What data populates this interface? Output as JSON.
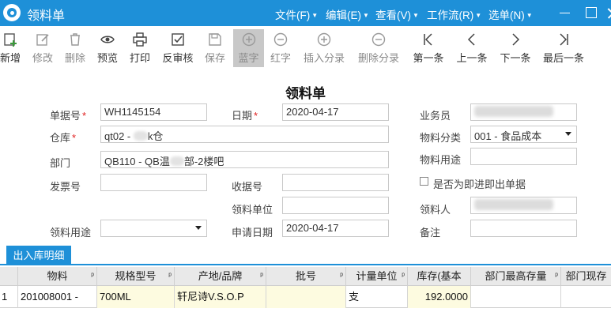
{
  "window": {
    "title": "领料单",
    "menus": [
      {
        "label": "文件(F)"
      },
      {
        "label": "编辑(E)"
      },
      {
        "label": "查看(V)"
      },
      {
        "label": "工作流(R)"
      },
      {
        "label": "选单(N)"
      }
    ]
  },
  "toolbar": {
    "buttons": [
      {
        "label": "新增",
        "icon": "add-icon"
      },
      {
        "label": "修改",
        "icon": "edit-icon"
      },
      {
        "label": "删除",
        "icon": "trash-icon"
      },
      {
        "label": "预览",
        "icon": "eye-icon"
      },
      {
        "label": "打印",
        "icon": "printer-icon"
      },
      {
        "label": "反审核",
        "icon": "checkbox-icon"
      },
      {
        "label": "保存",
        "icon": "save-icon"
      },
      {
        "label": "蓝字",
        "icon": "plus-circle-icon"
      },
      {
        "label": "红字",
        "icon": "minus-circle-icon"
      },
      {
        "label": "插入分录",
        "icon": "plus-circle-icon"
      },
      {
        "label": "删除分录",
        "icon": "minus-circle-icon"
      },
      {
        "label": "第一条",
        "icon": "first-icon"
      },
      {
        "label": "上一条",
        "icon": "prev-icon"
      },
      {
        "label": "下一条",
        "icon": "next-icon"
      },
      {
        "label": "最后一条",
        "icon": "last-icon"
      }
    ]
  },
  "form": {
    "title": "领料单",
    "bill_no_label": "单据号",
    "bill_no": "WH1145154",
    "date_label": "日期",
    "date": "2020-04-17",
    "clerk_label": "业务员",
    "warehouse_label": "仓库",
    "warehouse_prefix": "qt02 - ",
    "warehouse_suffix": "k仓",
    "category_label": "物料分类",
    "category": "001 - 食品成本",
    "dept_label": "部门",
    "dept_prefix": "QB110 - QB温",
    "dept_suffix": "部-2楼吧",
    "material_use_label": "物料用途",
    "invoice_label": "发票号",
    "receipt_label": "收据号",
    "checkbox_label": "是否为即进即出单据",
    "unit_label": "领料单位",
    "receiver_label": "领料人",
    "use_label": "领料用途",
    "apply_date_label": "申请日期",
    "apply_date": "2020-04-17",
    "remark_label": "备注"
  },
  "tab": {
    "label": "出入库明细"
  },
  "grid": {
    "columns": [
      "物料",
      "规格型号",
      "产地/品牌",
      "批号",
      "计量单位",
      "库存(基本",
      "部门最高存量",
      "部门现存"
    ],
    "rows": [
      {
        "index": "1",
        "material": "201008001 -",
        "spec": "700ML",
        "brand": "轩尼诗V.S.O.P",
        "batch": "",
        "unit": "支",
        "stock": "192.0000"
      }
    ]
  }
}
